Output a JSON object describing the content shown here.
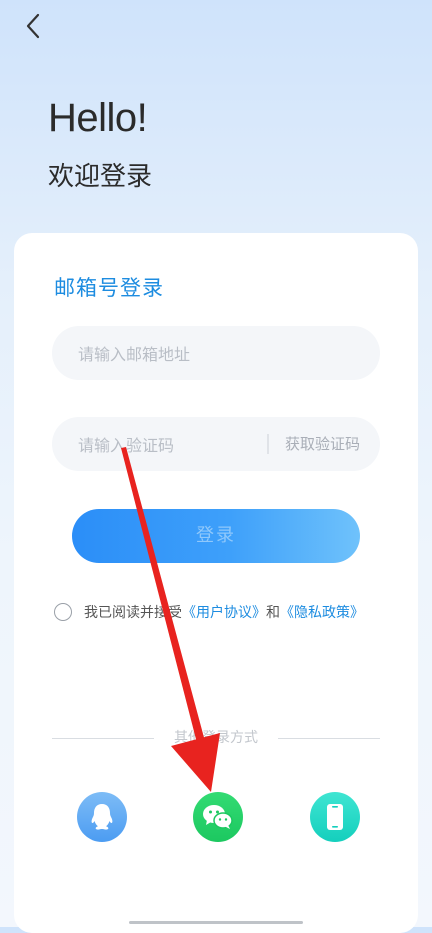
{
  "header": {
    "back_icon": "chevron-left-icon",
    "hello": "Hello!",
    "welcome": "欢迎登录"
  },
  "form": {
    "title": "邮箱号登录",
    "email_placeholder": "请输入邮箱地址",
    "code_placeholder": "请输入验证码",
    "get_code": "获取验证码",
    "login_label": "登录"
  },
  "agreement": {
    "prefix": "我已阅读并接受",
    "user_agreement": "《用户协议》",
    "and": "和",
    "privacy_policy": "《隐私政策》"
  },
  "other_login": {
    "label": "其他登录方式",
    "icons": [
      "qq-icon",
      "wechat-icon",
      "phone-icon"
    ]
  },
  "colors": {
    "accent": "#1d8ce0",
    "wechat": "#1cc860",
    "annotation_arrow": "#e8231f"
  }
}
